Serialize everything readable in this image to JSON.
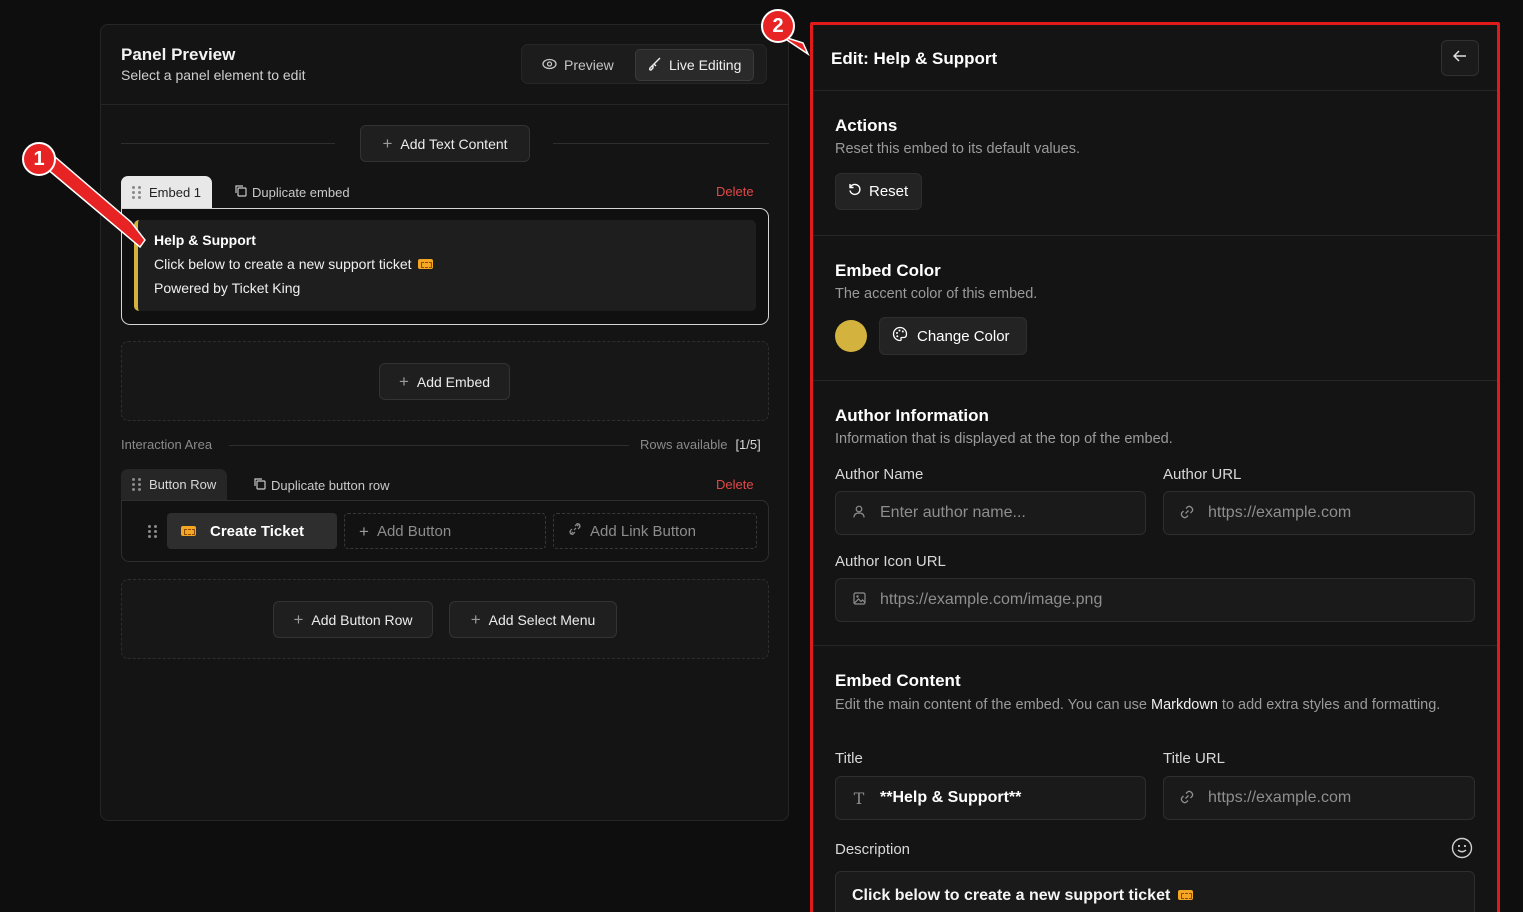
{
  "left_panel": {
    "title": "Panel Preview",
    "subtitle": "Select a panel element to edit",
    "mode_preview": "Preview",
    "mode_live": "Live Editing",
    "add_text_content": "Add Text Content",
    "embed_tab": "Embed 1",
    "duplicate_embed": "Duplicate embed",
    "delete": "Delete",
    "embed": {
      "title": "Help & Support",
      "description": "Click below to create a new support ticket",
      "footer": "Powered by Ticket King",
      "color": "#d4b23e"
    },
    "add_embed": "Add Embed",
    "interaction_area": "Interaction Area",
    "rows_available_label": "Rows available",
    "rows_available_value": "[1/5]",
    "button_row_tab": "Button Row",
    "duplicate_button_row": "Duplicate button row",
    "create_ticket": "Create Ticket",
    "add_button": "Add Button",
    "add_link_button": "Add Link Button",
    "add_button_row": "Add Button Row",
    "add_select_menu": "Add Select Menu"
  },
  "right_panel": {
    "title": "Edit: Help & Support",
    "actions": {
      "title": "Actions",
      "desc": "Reset this embed to its default values.",
      "reset": "Reset"
    },
    "embed_color": {
      "title": "Embed Color",
      "desc": "The accent color of this embed.",
      "change": "Change Color",
      "value": "#d4b23e"
    },
    "author": {
      "title": "Author Information",
      "desc": "Information that is displayed at the top of the embed.",
      "name_label": "Author Name",
      "name_placeholder": "Enter author name...",
      "url_label": "Author URL",
      "url_placeholder": "https://example.com",
      "icon_label": "Author Icon URL",
      "icon_placeholder": "https://example.com/image.png"
    },
    "content": {
      "title": "Embed Content",
      "desc_pre": "Edit the main content of the embed. You can use ",
      "desc_link": "Markdown",
      "desc_post": " to add extra styles and formatting.",
      "title_label": "Title",
      "title_value": "**Help & Support**",
      "title_url_label": "Title URL",
      "title_url_placeholder": "https://example.com",
      "description_label": "Description",
      "description_value": "Click below to create a new support ticket"
    }
  },
  "annotations": {
    "one": "1",
    "two": "2"
  },
  "colors": {
    "accent_red": "#e01b1b",
    "embed_gold": "#d4b23e",
    "delete_red": "#e04848"
  }
}
